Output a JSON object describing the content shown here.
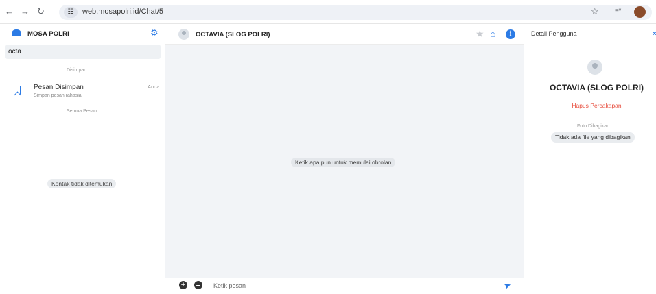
{
  "browser": {
    "url": "web.mosapolri.id/Chat/5",
    "back_icon": "arrow-left-icon",
    "forward_icon": "arrow-right-icon",
    "reload_icon": "reload-icon"
  },
  "sidebar": {
    "brand": "MOSA POLRI",
    "search_value": "octa",
    "saved_section": "Disimpan",
    "saved_item": {
      "title": "Pesan Disimpan",
      "subtitle": "Simpan pesan rahasia",
      "meta": "Anda"
    },
    "all_section": "Semua Pesan",
    "empty_text": "Kontak tidak ditemukan"
  },
  "chat": {
    "title": "OCTAVIA (SLOG POLRI)",
    "hint": "Ketik apa pun untuk memulai obrolan",
    "input_placeholder": "Ketik pesan"
  },
  "details": {
    "title": "Detail Pengguna",
    "name": "OCTAVIA (SLOG POLRI)",
    "delete_label": "Hapus Percakapan",
    "shared_section": "Foto Dibagikan",
    "no_files": "Tidak ada file yang dibagikan"
  },
  "colors": {
    "accent": "#2c7be5",
    "danger": "#e74c3c"
  }
}
